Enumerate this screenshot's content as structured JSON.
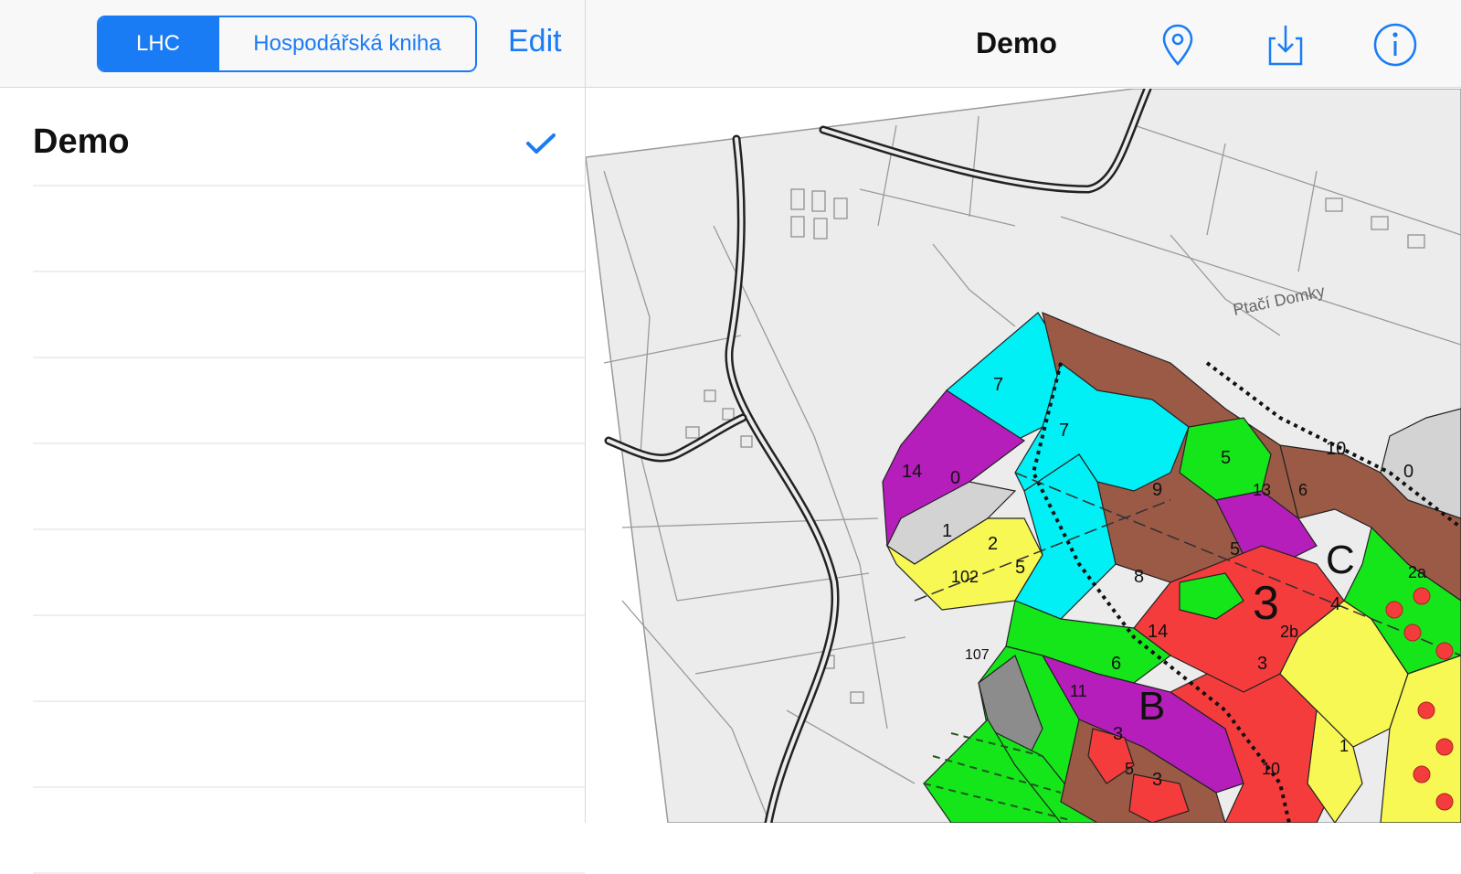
{
  "navbar": {
    "segments": {
      "selected": "LHC",
      "other": "Hospodářská kniha"
    },
    "edit_label": "Edit",
    "title": "Demo",
    "icons": [
      "location-pin-icon",
      "download-icon",
      "info-icon"
    ],
    "accent_color": "#1a7cf5"
  },
  "list": {
    "items": [
      {
        "label": "Demo",
        "checked": true
      }
    ]
  },
  "map": {
    "street_label": "Ptačí Domky",
    "stand_labels": [
      "7",
      "7",
      "14",
      "0",
      "1",
      "2",
      "102",
      "5",
      "9",
      "5",
      "10",
      "13",
      "6",
      "5",
      "C",
      "3",
      "2b",
      "4",
      "2a",
      "0",
      "8",
      "14",
      "107",
      "11",
      "6",
      "B",
      "3",
      "3",
      "3",
      "5",
      "10",
      "1"
    ],
    "colors": {
      "cyan": "#00f0f5",
      "brown": "#9b5a46",
      "green": "#15e61a",
      "magenta": "#b51eba",
      "yellow": "#f8f854",
      "red": "#f53c3c",
      "gray": "#8c8c8c",
      "light_gray": "#d3d3d3"
    }
  }
}
